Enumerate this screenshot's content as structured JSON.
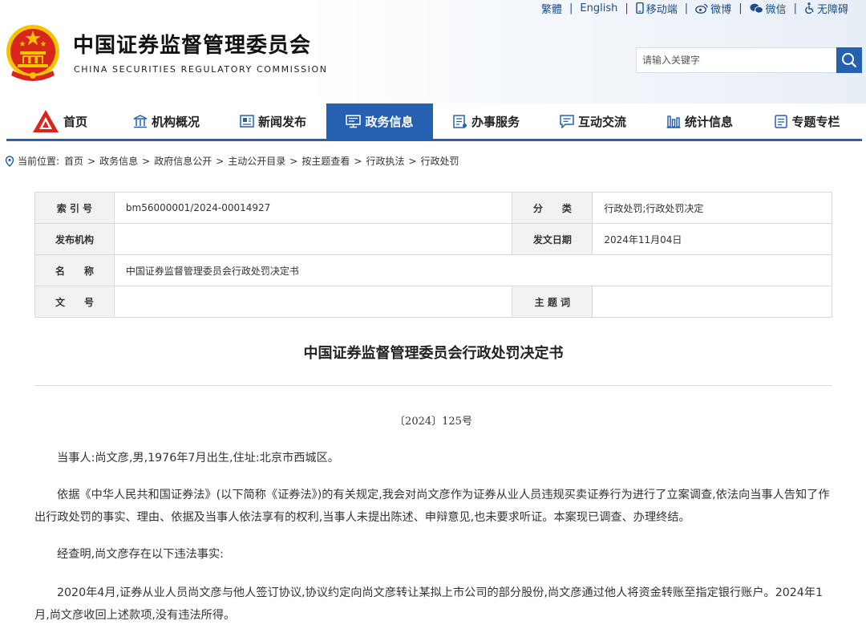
{
  "top_links": {
    "traditional": "繁體",
    "english": "English",
    "mobile": "移动端",
    "weibo": "微博",
    "wechat": "微信",
    "accessibility": "无障碍"
  },
  "site": {
    "title": "中国证券监督管理委员会",
    "subtitle": "CHINA SECURITIES REGULATORY COMMISSION"
  },
  "search": {
    "placeholder": "请输入关键字"
  },
  "nav": {
    "items": [
      {
        "label": "首页",
        "icon": "csrc-logo-icon"
      },
      {
        "label": "机构概况",
        "icon": "building-icon"
      },
      {
        "label": "新闻发布",
        "icon": "newspaper-icon"
      },
      {
        "label": "政务信息",
        "icon": "monitor-icon"
      },
      {
        "label": "办事服务",
        "icon": "document-list-icon"
      },
      {
        "label": "互动交流",
        "icon": "chat-icon"
      },
      {
        "label": "统计信息",
        "icon": "bar-chart-icon"
      },
      {
        "label": "专题专栏",
        "icon": "page-icon"
      }
    ],
    "active_index": 3
  },
  "breadcrumb": {
    "prefix": "当前位置:",
    "items": [
      "首页",
      "政务信息",
      "政府信息公开",
      "主动公开目录",
      "按主题查看",
      "行政执法",
      "行政处罚"
    ]
  },
  "info": {
    "index_label": "索 引 号",
    "index_value": "bm56000001/2024-00014927",
    "category_label": "分　　类",
    "category_value": "行政处罚;行政处罚决定",
    "issuer_label": "发布机构",
    "issuer_value": "",
    "date_label": "发文日期",
    "date_value": "2024年11月04日",
    "name_label": "名　　称",
    "name_value": "中国证券监督管理委员会行政处罚决定书",
    "docno_label": "文　　号",
    "docno_value": "",
    "topic_label": "主 题 词",
    "topic_value": ""
  },
  "document": {
    "title": "中国证券监督管理委员会行政处罚决定书",
    "number": "〔2024〕125号",
    "paragraphs": [
      "当事人:尚文彦,男,1976年7月出生,住址:北京市西城区。",
      "依据《中华人民共和国证券法》(以下简称《证券法》)的有关规定,我会对尚文彦作为证券从业人员违规买卖证券行为进行了立案调查,依法向当事人告知了作出行政处罚的事实、理由、依据及当事人依法享有的权利,当事人未提出陈述、申辩意见,也未要求听证。本案现已调查、办理终结。",
      "经查明,尚文彦存在以下违法事实:",
      "2020年4月,证券从业人员尚文彦与他人签订协议,协议约定向尚文彦转让某拟上市公司的部分股份,尚文彦通过他人将资金转账至指定银行账户。2024年1月,尚文彦收回上述款项,没有违法所得。"
    ]
  },
  "colors": {
    "brand_blue": "#2561b0",
    "emblem_red": "#d9261c",
    "emblem_gold": "#f5c400"
  }
}
